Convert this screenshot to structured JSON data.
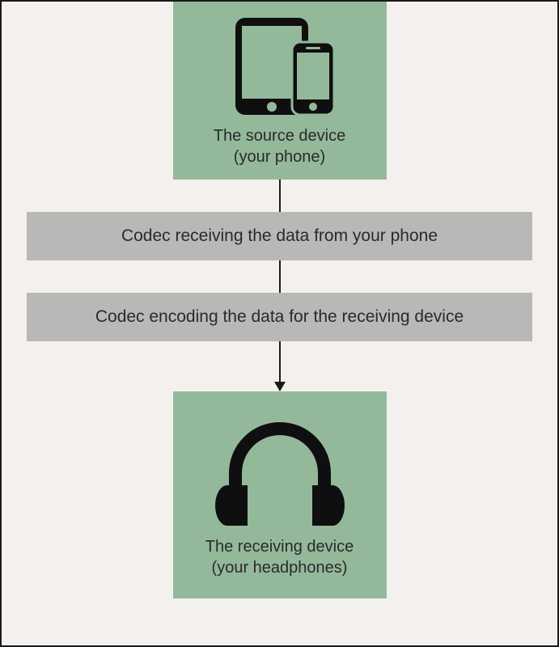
{
  "source": {
    "label_line1": "The source device",
    "label_line2": "(your phone)"
  },
  "codec1": {
    "label": "Codec receiving the data from your phone"
  },
  "codec2": {
    "label": "Codec encoding the data for the receiving device"
  },
  "receiver": {
    "label_line1": "The receiving device",
    "label_line2": "(your headphones)"
  }
}
